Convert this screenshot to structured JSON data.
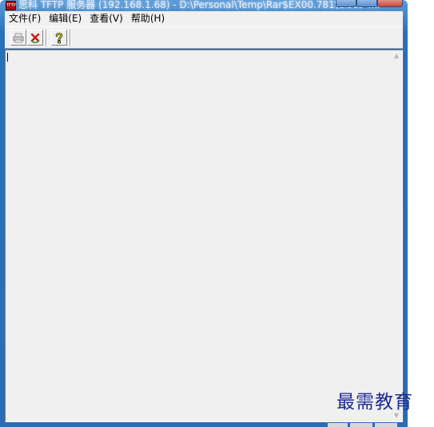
{
  "window": {
    "title": "思科 TFTP 服务器 (192.168.1.68) - D:\\Personal\\Temp\\Rar$EX00.781\\Cisco T...",
    "app_icon_text": "TFTP"
  },
  "menu": {
    "items": [
      {
        "label": "文件(F)"
      },
      {
        "label": "编辑(E)"
      },
      {
        "label": "查看(V)"
      },
      {
        "label": "帮助(H)"
      }
    ]
  },
  "toolbar": {
    "buttons": [
      {
        "icon": "printer-icon"
      },
      {
        "icon": "clear-log-icon"
      },
      {
        "icon": "help-icon"
      }
    ]
  },
  "log": {
    "content": ""
  },
  "scrollbar": {
    "up_glyph": "▲",
    "down_glyph": "▼"
  },
  "watermark": {
    "text": "最需教育"
  },
  "colors": {
    "titlebar": "#2a6fb8",
    "client_bg": "#f0f0f0",
    "watermark": "#1e2a90"
  }
}
